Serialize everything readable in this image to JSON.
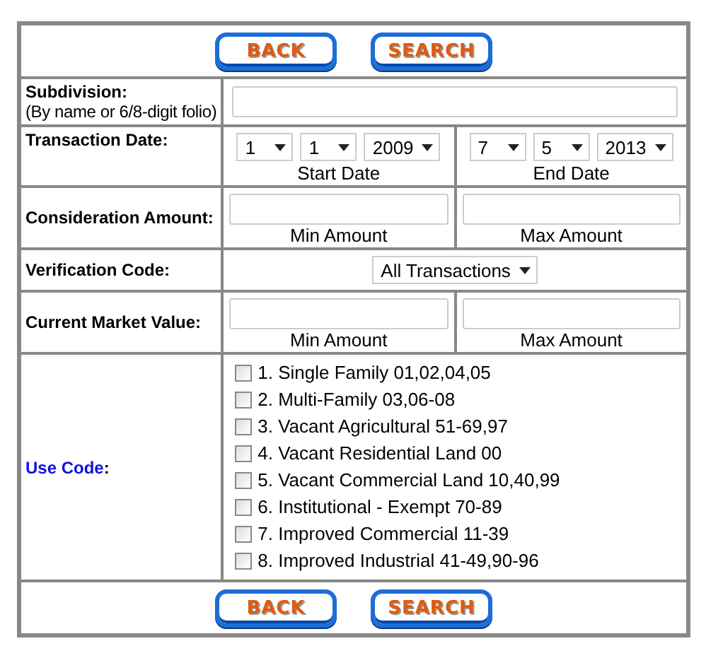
{
  "top_buttons": [
    "BACK",
    "SEARCH"
  ],
  "rows": [
    {
      "kind": "text",
      "label": "Subdivision:",
      "hint": "(By name or 6/8-digit folio)"
    },
    {
      "kind": "dates",
      "label": "Transaction Date:",
      "groups": [
        {
          "caption": "Start Date",
          "selects": [
            "1",
            "1",
            "2009"
          ]
        },
        {
          "caption": "End Date",
          "selects": [
            "7",
            "5",
            "2013"
          ]
        }
      ]
    },
    {
      "kind": "range",
      "label": "Consideration Amount:",
      "captions": [
        "Min Amount",
        "Max Amount"
      ]
    },
    {
      "kind": "select",
      "label": "Verification Code:",
      "value": "All Transactions"
    },
    {
      "kind": "range",
      "label": "Current Market Value:",
      "captions": [
        "Min Amount",
        "Max Amount"
      ]
    },
    {
      "kind": "checks",
      "label": "Use Code",
      "suffix": ":",
      "options": [
        {
          "label": "1. Single Family 01,02,04,05",
          "checked": false
        },
        {
          "label": "2. Multi-Family 03,06-08",
          "checked": false
        },
        {
          "label": "3. Vacant Agricultural 51-69,97",
          "checked": false
        },
        {
          "label": "4. Vacant Residential Land 00",
          "checked": false
        },
        {
          "label": "5. Vacant Commercial Land 10,40,99",
          "checked": false
        },
        {
          "label": "6. Institutional - Exempt 70-89",
          "checked": false
        },
        {
          "label": "7. Improved Commercial 11-39",
          "checked": false
        },
        {
          "label": "8. Improved Industrial 41-49,90-96",
          "checked": false
        }
      ]
    }
  ],
  "bottom_buttons": [
    "BACK",
    "SEARCH"
  ]
}
